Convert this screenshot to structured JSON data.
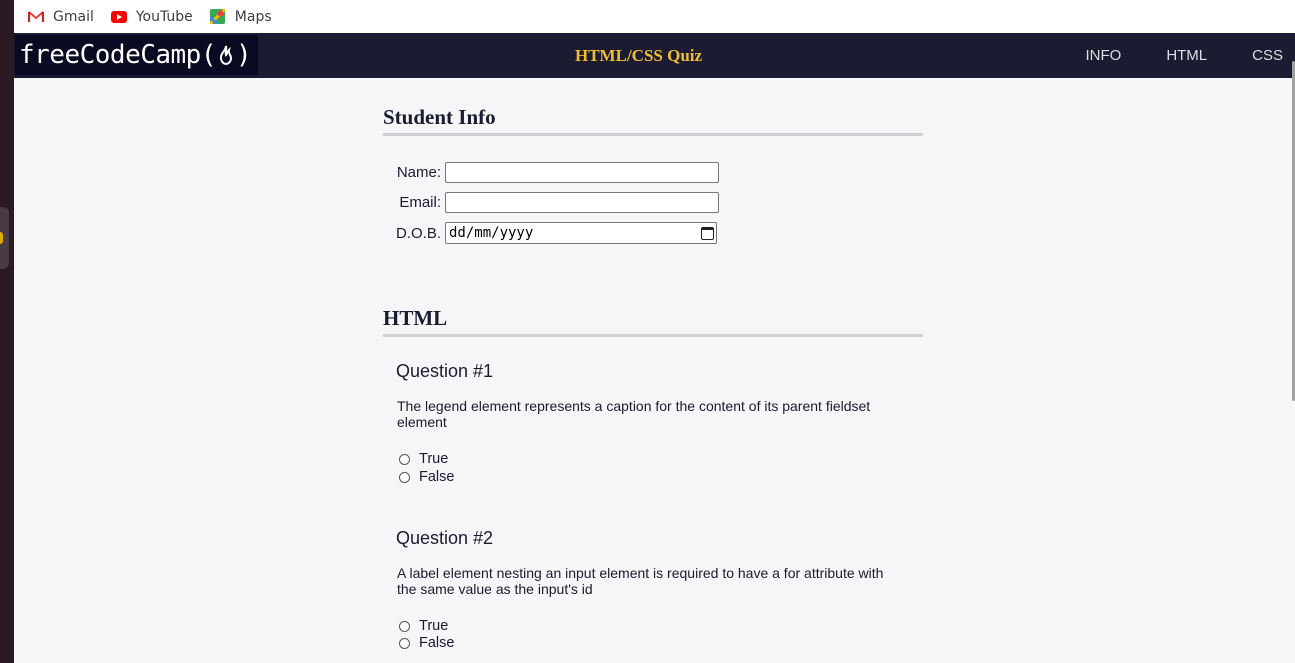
{
  "bookmarks": [
    {
      "label": "Gmail",
      "icon": "gmail-icon"
    },
    {
      "label": "YouTube",
      "icon": "youtube-icon"
    },
    {
      "label": "Maps",
      "icon": "maps-icon"
    }
  ],
  "navbar": {
    "logo_left": "freeCodeCamp(",
    "logo_right": ")",
    "title": "HTML/CSS Quiz",
    "links": [
      "INFO",
      "HTML",
      "CSS"
    ]
  },
  "student_info": {
    "heading": "Student Info",
    "name_label": "Name:",
    "email_label": "Email:",
    "dob_label": "D.O.B.",
    "dob_placeholder": "dd/mm/yyyy"
  },
  "html_section": {
    "heading": "HTML",
    "questions": [
      {
        "title": "Question #1",
        "text": "The legend element represents a caption for the content of its parent fieldset element",
        "options": [
          "True",
          "False"
        ]
      },
      {
        "title": "Question #2",
        "text": "A label element nesting an input element is required to have a for attribute with the same value as the input's id",
        "options": [
          "True",
          "False"
        ]
      }
    ]
  },
  "colors": {
    "nav_bg": "#1b1b32",
    "logo_bg": "#0a0a23",
    "title_accent": "#f1be32",
    "page_bg": "#f5f6f7"
  }
}
